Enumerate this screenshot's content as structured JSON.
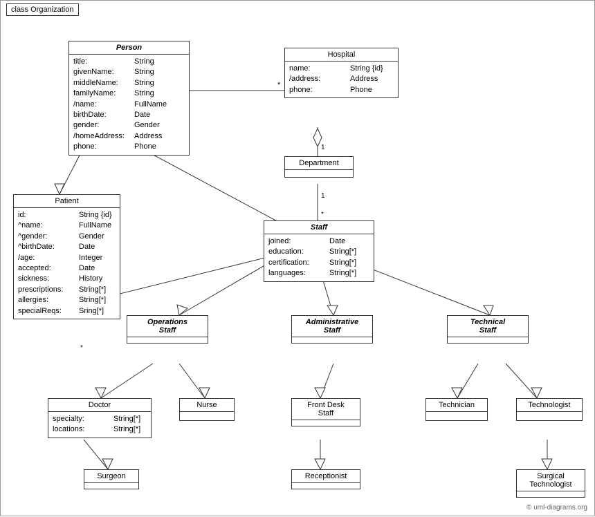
{
  "diagram": {
    "title": "class Organization",
    "copyright": "© uml-diagrams.org",
    "classes": {
      "person": {
        "name": "Person",
        "italic": true,
        "attrs": [
          {
            "name": "title:",
            "type": "String"
          },
          {
            "name": "givenName:",
            "type": "String"
          },
          {
            "name": "middleName:",
            "type": "String"
          },
          {
            "name": "familyName:",
            "type": "String"
          },
          {
            "name": "/name:",
            "type": "FullName"
          },
          {
            "name": "birthDate:",
            "type": "Date"
          },
          {
            "name": "gender:",
            "type": "Gender"
          },
          {
            "name": "/homeAddress:",
            "type": "Address"
          },
          {
            "name": "phone:",
            "type": "Phone"
          }
        ]
      },
      "hospital": {
        "name": "Hospital",
        "attrs": [
          {
            "name": "name:",
            "type": "String {id}"
          },
          {
            "name": "/address:",
            "type": "Address"
          },
          {
            "name": "phone:",
            "type": "Phone"
          }
        ]
      },
      "department": {
        "name": "Department",
        "attrs": []
      },
      "staff": {
        "name": "Staff",
        "italic": true,
        "attrs": [
          {
            "name": "joined:",
            "type": "Date"
          },
          {
            "name": "education:",
            "type": "String[*]"
          },
          {
            "name": "certification:",
            "type": "String[*]"
          },
          {
            "name": "languages:",
            "type": "String[*]"
          }
        ]
      },
      "patient": {
        "name": "Patient",
        "attrs": [
          {
            "name": "id:",
            "type": "String {id}"
          },
          {
            "name": "^name:",
            "type": "FullName"
          },
          {
            "name": "^gender:",
            "type": "Gender"
          },
          {
            "name": "^birthDate:",
            "type": "Date"
          },
          {
            "name": "/age:",
            "type": "Integer"
          },
          {
            "name": "accepted:",
            "type": "Date"
          },
          {
            "name": "sickness:",
            "type": "History"
          },
          {
            "name": "prescriptions:",
            "type": "String[*]"
          },
          {
            "name": "allergies:",
            "type": "String[*]"
          },
          {
            "name": "specialReqs:",
            "type": "Sring[*]"
          }
        ]
      },
      "operations_staff": {
        "name": "Operations Staff",
        "italic": true,
        "attrs": []
      },
      "administrative_staff": {
        "name": "Administrative Staff",
        "italic": true,
        "attrs": []
      },
      "technical_staff": {
        "name": "Technical Staff",
        "italic": true,
        "attrs": []
      },
      "doctor": {
        "name": "Doctor",
        "attrs": [
          {
            "name": "specialty:",
            "type": "String[*]"
          },
          {
            "name": "locations:",
            "type": "String[*]"
          }
        ]
      },
      "nurse": {
        "name": "Nurse",
        "attrs": []
      },
      "front_desk_staff": {
        "name": "Front Desk Staff",
        "attrs": []
      },
      "technician": {
        "name": "Technician",
        "attrs": []
      },
      "technologist": {
        "name": "Technologist",
        "attrs": []
      },
      "surgeon": {
        "name": "Surgeon",
        "attrs": []
      },
      "receptionist": {
        "name": "Receptionist",
        "attrs": []
      },
      "surgical_technologist": {
        "name": "Surgical Technologist",
        "attrs": []
      }
    }
  }
}
